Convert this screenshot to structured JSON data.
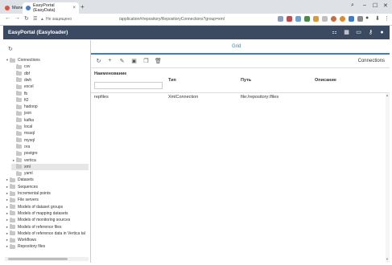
{
  "browser": {
    "tabs": [
      {
        "label": "Mane",
        "color": "#e74c3c"
      },
      {
        "label": "EasyPortal (EasyData)",
        "color": "#4a7bd0"
      }
    ],
    "new_tab": "+",
    "address": {
      "host": "Не защищено",
      "path": "/application#/repository/RepositoryConnections?group=xml"
    },
    "extensions": [
      "#8aa0c0",
      "#c74848",
      "#6aa0d8",
      "#4a8a4a",
      "#d89a3a",
      "#c0c0c0",
      "#d06a3a",
      "#e08a2a",
      "#3a7ad0",
      "#8a8a8a"
    ]
  },
  "app": {
    "title": "EasyPortal (Easyloader)",
    "header_icons": [
      "grid-settings-icon",
      "apps-icon",
      "folder-icon",
      "key-icon",
      "user-icon"
    ]
  },
  "tree": {
    "items": [
      {
        "label": "Connections",
        "level": 0,
        "expanded": true
      },
      {
        "label": "csv",
        "level": 1
      },
      {
        "label": "dbf",
        "level": 1
      },
      {
        "label": "dwh",
        "level": 1
      },
      {
        "label": "excel",
        "level": 1
      },
      {
        "label": "fb",
        "level": 1
      },
      {
        "label": "ft2",
        "level": 1
      },
      {
        "label": "hadoop",
        "level": 1
      },
      {
        "label": "json",
        "level": 1
      },
      {
        "label": "kafka",
        "level": 1
      },
      {
        "label": "local",
        "level": 1
      },
      {
        "label": "mssql",
        "level": 1
      },
      {
        "label": "mysql",
        "level": 1
      },
      {
        "label": "ora",
        "level": 1
      },
      {
        "label": "postgre",
        "level": 1
      },
      {
        "label": "vertica",
        "level": 1,
        "collapsed": true
      },
      {
        "label": "xml",
        "level": 1,
        "selected": true
      },
      {
        "label": "yaml",
        "level": 1
      },
      {
        "label": "Datasets",
        "level": 0,
        "collapsed": true
      },
      {
        "label": "Sequences",
        "level": 0,
        "collapsed": true
      },
      {
        "label": "Incremental points",
        "level": 0,
        "collapsed": true
      },
      {
        "label": "File servers",
        "level": 0,
        "collapsed": true
      },
      {
        "label": "Models of dataset groups",
        "level": 0,
        "collapsed": true
      },
      {
        "label": "Models of mapping datasets",
        "level": 0,
        "collapsed": true
      },
      {
        "label": "Models of monitoring sources",
        "level": 0,
        "collapsed": true
      },
      {
        "label": "Models of reference files",
        "level": 0,
        "collapsed": true
      },
      {
        "label": "Models of reference data in Vertica tal",
        "level": 0,
        "collapsed": true
      },
      {
        "label": "Workflows",
        "level": 0,
        "collapsed": true
      },
      {
        "label": "Repository files",
        "level": 0,
        "collapsed": true
      }
    ]
  },
  "grid": {
    "tab_label": "Grid",
    "title": "Connections",
    "toolbar": [
      "refresh-icon",
      "add-icon",
      "edit-icon",
      "save-icon",
      "copy-icon",
      "delete-icon"
    ],
    "columns": [
      "Наименование",
      "Тип",
      "Путь",
      "Описание"
    ],
    "filter_value": "",
    "rows": [
      {
        "name": "repfiles",
        "type": "XmlConnection",
        "path": "file:/repository:/files",
        "description": ""
      }
    ]
  }
}
